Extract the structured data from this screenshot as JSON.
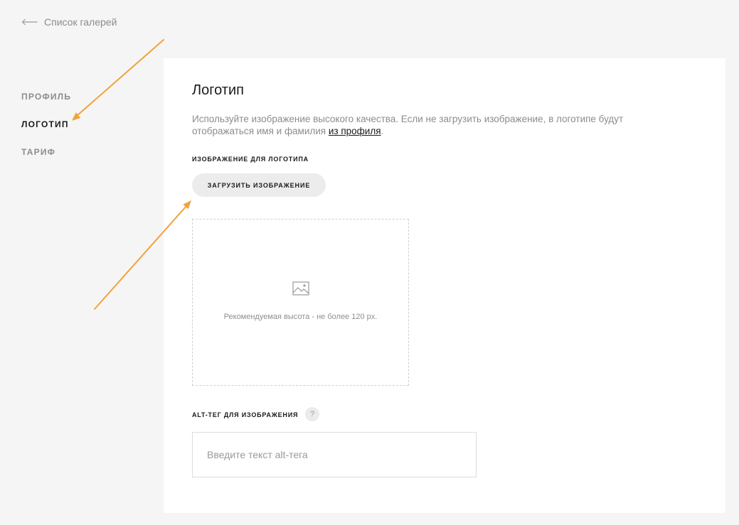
{
  "back_link": {
    "icon": "arrow-left-icon",
    "label": "Список галерей"
  },
  "sidebar": {
    "items": [
      {
        "label": "ПРОФИЛЬ",
        "active": false
      },
      {
        "label": "ЛОГОТИП",
        "active": true
      },
      {
        "label": "ТАРИФ",
        "active": false
      }
    ]
  },
  "main": {
    "title": "Логотип",
    "description": {
      "line1": "Используйте изображение высокого качества. Если не загрузить изображение, в логотипе будут",
      "line2": "отображаться имя и фамилия ",
      "link": "из профиля",
      "end": "."
    },
    "image_section": {
      "label": "ИЗОБРАЖЕНИЕ ДЛЯ ЛОГОТИПА",
      "upload_button": "ЗАГРУЗИТЬ ИЗОБРАЖЕНИЕ",
      "dropzone": {
        "icon": "image-icon",
        "hint": "Рекомендуемая высота - не более 120 px."
      }
    },
    "alt_section": {
      "label": "ALT-ТЕГ ДЛЯ ИЗОБРАЖЕНИЯ",
      "help": "?",
      "input": {
        "value": "",
        "placeholder": "Введите текст alt-тега"
      }
    }
  },
  "annotations": {
    "icon": "annotation-arrow-icon"
  },
  "theme": {
    "page_background": "#f5f5f5",
    "panel_background": "#ffffff",
    "text_primary": "#1a1a1a",
    "text_muted": "#8c8c8c",
    "button_background": "#ececec",
    "annotation_color": "#f2a23a"
  }
}
